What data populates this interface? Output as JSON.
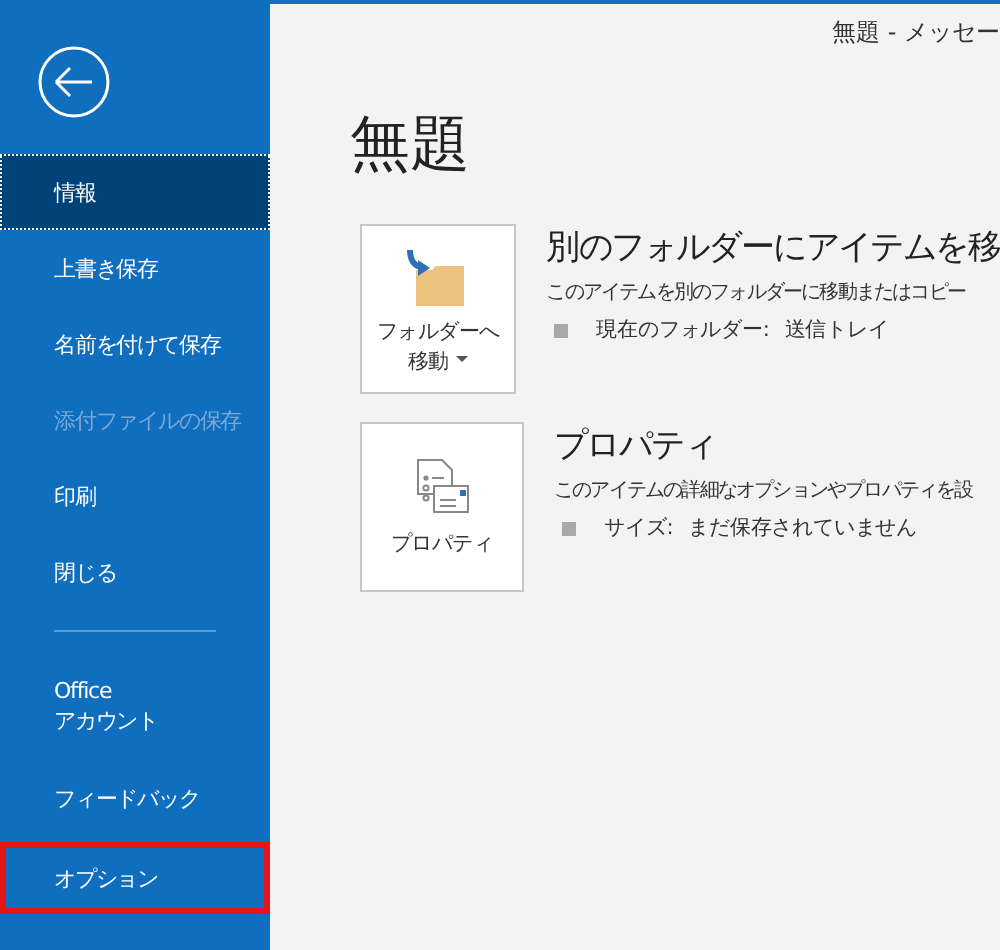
{
  "window": {
    "title": "無題 - メッセー"
  },
  "sidebar": {
    "items": [
      {
        "label": "情報",
        "selected": true,
        "disabled": false,
        "outlined": false
      },
      {
        "label": "上書き保存",
        "selected": false,
        "disabled": false,
        "outlined": false
      },
      {
        "label": "名前を付けて保存",
        "selected": false,
        "disabled": false,
        "outlined": false
      },
      {
        "label": "添付ファイルの保存",
        "selected": false,
        "disabled": true,
        "outlined": false
      },
      {
        "label": "印刷",
        "selected": false,
        "disabled": false,
        "outlined": false
      },
      {
        "label": "閉じる",
        "selected": false,
        "disabled": false,
        "outlined": false
      },
      {
        "kind": "separator"
      },
      {
        "label": "Office\nアカウント",
        "selected": false,
        "disabled": false,
        "outlined": false
      },
      {
        "label": "フィードバック",
        "selected": false,
        "disabled": false,
        "outlined": false
      },
      {
        "label": "オプション",
        "selected": false,
        "disabled": false,
        "outlined": true
      }
    ]
  },
  "heading": "無題",
  "sections": [
    {
      "kind": "move",
      "button": [
        "フォルダーへ",
        "移動"
      ],
      "dropdown": true,
      "title": "別のフォルダーにアイテムを移",
      "description": "このアイテムを別のフォルダーに移動またはコピー",
      "detail_label": "現在のフォルダー:",
      "detail_value": "送信トレイ"
    },
    {
      "kind": "properties",
      "button": [
        "プロパティ"
      ],
      "dropdown": false,
      "title": "プロパティ",
      "description": "このアイテムの詳細なオプションやプロパティを設",
      "detail_label": "サイズ:",
      "detail_value": "まだ保存されていません"
    }
  ]
}
